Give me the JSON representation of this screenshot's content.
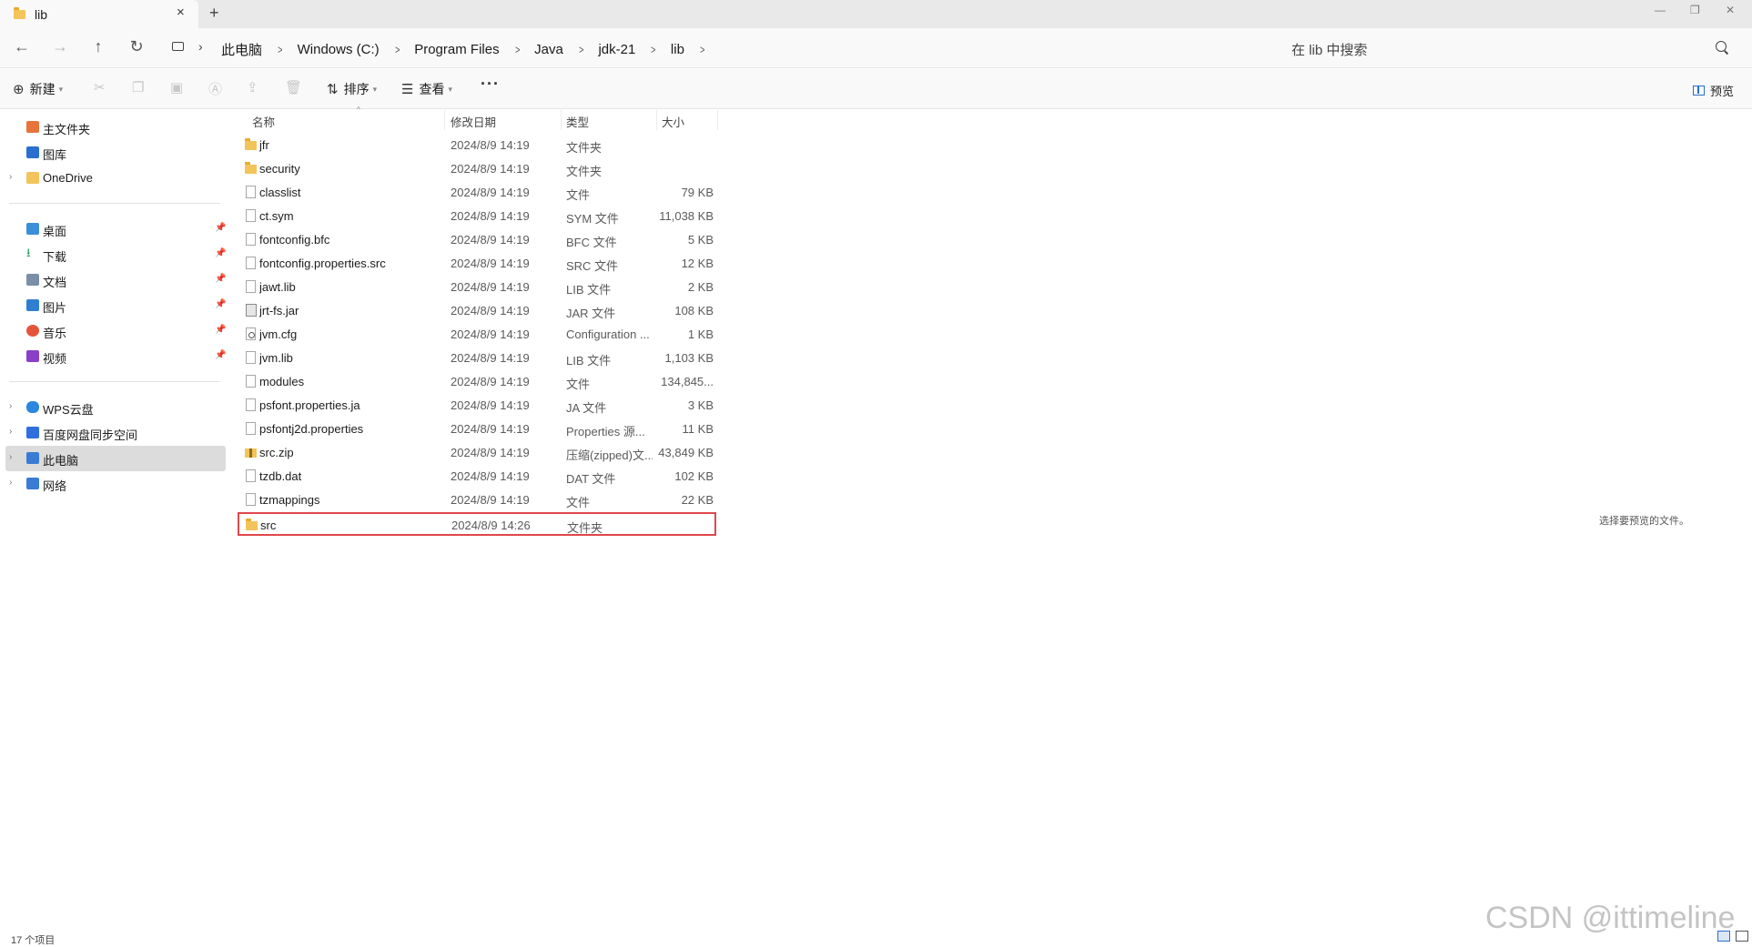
{
  "window": {
    "tab_title": "lib",
    "tab_close": "×",
    "new_tab": "+",
    "controls": {
      "minimize": "—",
      "restore": "❐",
      "close": "✕"
    }
  },
  "nav": {
    "back": "←",
    "forward": "→",
    "up": "↑",
    "refresh": "↻"
  },
  "breadcrumb": [
    "此电脑",
    "Windows (C:)",
    "Program Files",
    "Java",
    "jdk-21",
    "lib"
  ],
  "breadcrumb_sep": ">",
  "search": {
    "placeholder": "在 lib 中搜索"
  },
  "commands": {
    "new_label": "新建",
    "sort_label": "排序",
    "view_label": "查看",
    "more": "···",
    "preview_label": "预览"
  },
  "sidebar": {
    "top": [
      {
        "label": "主文件夹",
        "icon": "home-icon",
        "color": "#e8743b"
      },
      {
        "label": "图库",
        "icon": "gallery-icon",
        "color": "#2a6fcf"
      },
      {
        "label": "OneDrive",
        "icon": "folder-icon",
        "color": "#f2c45a"
      }
    ],
    "quick": [
      {
        "label": "桌面",
        "icon": "desktop-icon",
        "color": "#3b8ed8"
      },
      {
        "label": "下载",
        "icon": "download-icon",
        "color": "#2e9e5b"
      },
      {
        "label": "文档",
        "icon": "document-icon",
        "color": "#7b8ea8"
      },
      {
        "label": "图片",
        "icon": "pictures-icon",
        "color": "#2f7fd1"
      },
      {
        "label": "音乐",
        "icon": "music-icon",
        "color": "#e2553a"
      },
      {
        "label": "视频",
        "icon": "videos-icon",
        "color": "#8a3fc8"
      }
    ],
    "bottom": [
      {
        "label": "WPS云盘",
        "icon": "cloud-icon",
        "color": "#2a86e0"
      },
      {
        "label": "百度网盘同步空间",
        "icon": "baidu-drive-icon",
        "color": "#2f6fe0"
      },
      {
        "label": "此电脑",
        "icon": "pc-icon",
        "color": "#3a7bd5"
      },
      {
        "label": "网络",
        "icon": "network-icon",
        "color": "#3a7bd5"
      }
    ]
  },
  "columns": {
    "name": "名称",
    "date": "修改日期",
    "type": "类型",
    "size": "大小"
  },
  "files": [
    {
      "name": "jfr",
      "date": "2024/8/9 14:19",
      "type": "文件夹",
      "size": "",
      "kind": "folder"
    },
    {
      "name": "security",
      "date": "2024/8/9 14:19",
      "type": "文件夹",
      "size": "",
      "kind": "folder"
    },
    {
      "name": "classlist",
      "date": "2024/8/9 14:19",
      "type": "文件",
      "size": "79 KB",
      "kind": "file"
    },
    {
      "name": "ct.sym",
      "date": "2024/8/9 14:19",
      "type": "SYM 文件",
      "size": "11,038 KB",
      "kind": "file"
    },
    {
      "name": "fontconfig.bfc",
      "date": "2024/8/9 14:19",
      "type": "BFC 文件",
      "size": "5 KB",
      "kind": "file"
    },
    {
      "name": "fontconfig.properties.src",
      "date": "2024/8/9 14:19",
      "type": "SRC 文件",
      "size": "12 KB",
      "kind": "file"
    },
    {
      "name": "jawt.lib",
      "date": "2024/8/9 14:19",
      "type": "LIB 文件",
      "size": "2 KB",
      "kind": "file"
    },
    {
      "name": "jrt-fs.jar",
      "date": "2024/8/9 14:19",
      "type": "JAR 文件",
      "size": "108 KB",
      "kind": "jar"
    },
    {
      "name": "jvm.cfg",
      "date": "2024/8/9 14:19",
      "type": "Configuration ...",
      "size": "1 KB",
      "kind": "cfg"
    },
    {
      "name": "jvm.lib",
      "date": "2024/8/9 14:19",
      "type": "LIB 文件",
      "size": "1,103 KB",
      "kind": "file"
    },
    {
      "name": "modules",
      "date": "2024/8/9 14:19",
      "type": "文件",
      "size": "134,845...",
      "kind": "file"
    },
    {
      "name": "psfont.properties.ja",
      "date": "2024/8/9 14:19",
      "type": "JA 文件",
      "size": "3 KB",
      "kind": "file"
    },
    {
      "name": "psfontj2d.properties",
      "date": "2024/8/9 14:19",
      "type": "Properties 源...",
      "size": "11 KB",
      "kind": "file"
    },
    {
      "name": "src.zip",
      "date": "2024/8/9 14:19",
      "type": "压缩(zipped)文...",
      "size": "43,849 KB",
      "kind": "zip"
    },
    {
      "name": "tzdb.dat",
      "date": "2024/8/9 14:19",
      "type": "DAT 文件",
      "size": "102 KB",
      "kind": "file"
    },
    {
      "name": "tzmappings",
      "date": "2024/8/9 14:19",
      "type": "文件",
      "size": "22 KB",
      "kind": "file"
    },
    {
      "name": "src",
      "date": "2024/8/9 14:26",
      "type": "文件夹",
      "size": "",
      "kind": "folder",
      "highlighted": true
    }
  ],
  "preview_hint": "选择要预览的文件。",
  "status": {
    "item_count": "17 个项目"
  },
  "watermark": "CSDN @ittimeline",
  "colors": {
    "highlight_box": "#e0474c",
    "accent": "#2a6fcf",
    "folder": "#f2c45a"
  }
}
